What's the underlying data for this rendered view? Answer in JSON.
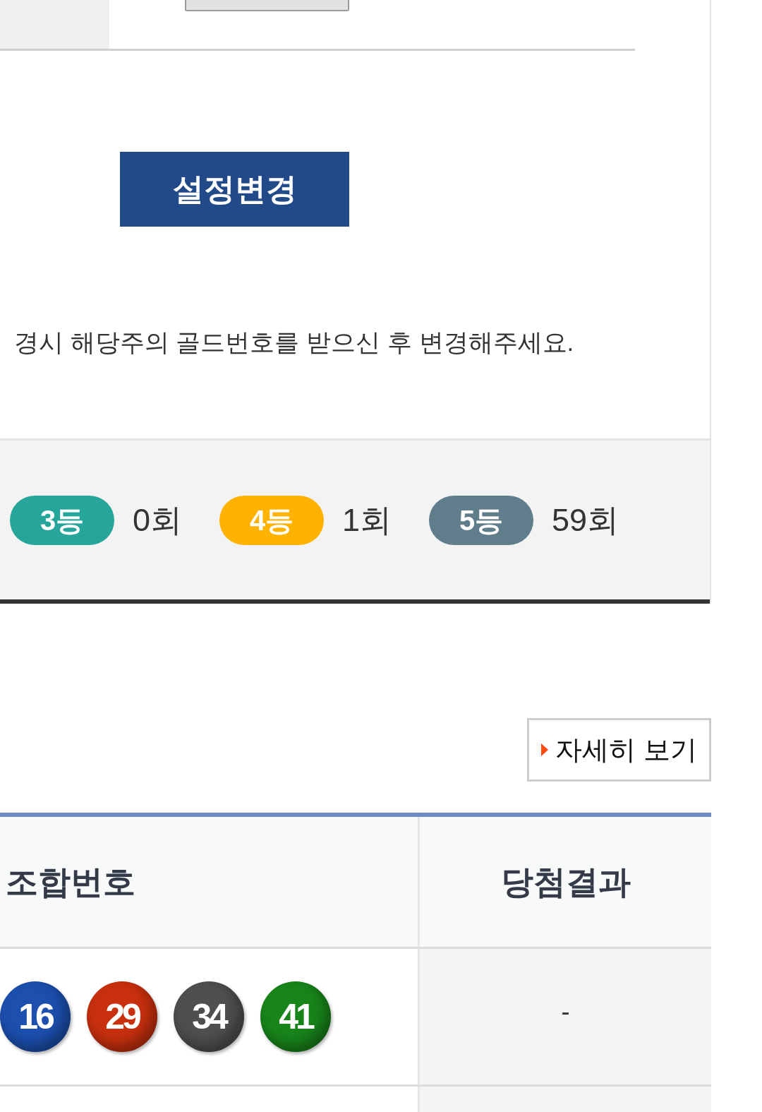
{
  "settings": {
    "change_button": "설정변경",
    "notice": "경시 해당주의 골드번호를 받으신 후 변경해주세요."
  },
  "rank_summary": [
    {
      "rank": "3등",
      "count": "0회",
      "color": "#26a69a"
    },
    {
      "rank": "4등",
      "count": "1회",
      "color": "#ffb300"
    },
    {
      "rank": "5등",
      "count": "59회",
      "color": "#607d8b"
    }
  ],
  "details_button": {
    "label": "자세히 보기"
  },
  "table": {
    "columns": [
      "조합번호",
      "당첨결과"
    ],
    "rows": [
      {
        "numbers": [
          {
            "value": "16",
            "color": "#1c4fae"
          },
          {
            "value": "29",
            "color": "#c8300e"
          },
          {
            "value": "34",
            "color": "#4f4f4f"
          },
          {
            "value": "41",
            "color": "#18851a"
          }
        ],
        "result": "-"
      }
    ]
  }
}
